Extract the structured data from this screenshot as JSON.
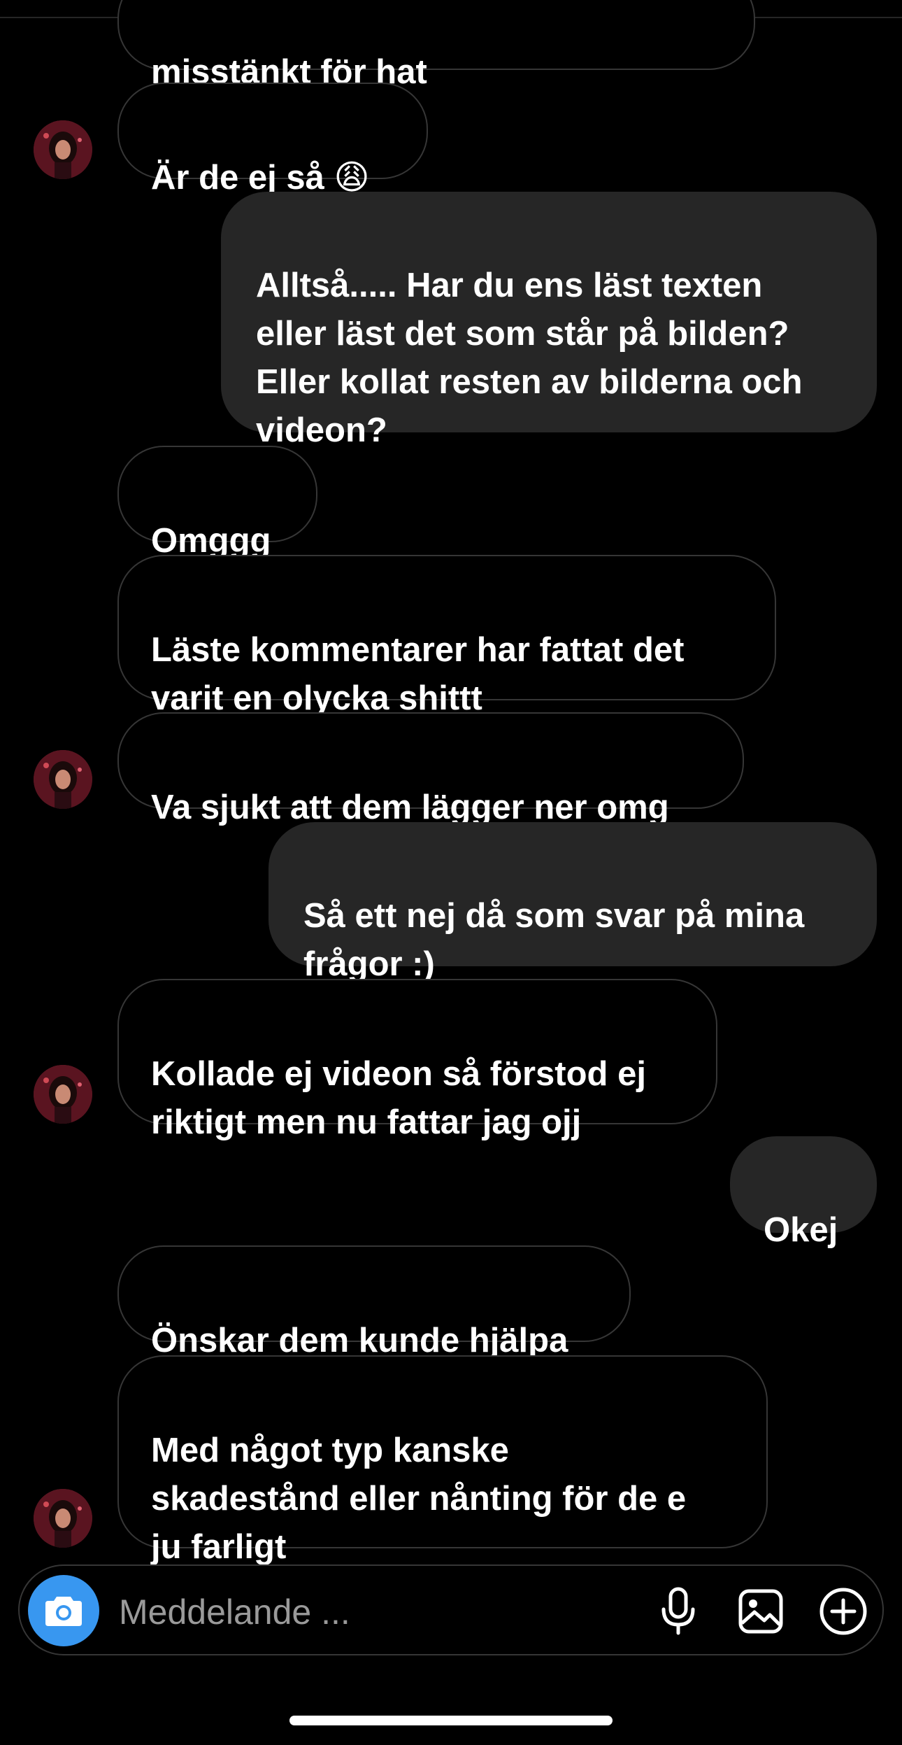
{
  "messages": [
    {
      "side": "in",
      "text": "misstänkt för hat"
    },
    {
      "side": "in",
      "text": "Är de ej så 😩"
    },
    {
      "side": "out",
      "text": "Alltså..... Har du ens läst texten\neller läst det som står på bilden?\nEller kollat resten av bilderna och\nvideon?"
    },
    {
      "side": "in",
      "text": "Omggg"
    },
    {
      "side": "in",
      "text": "Läste kommentarer har fattat det\nvarit en olycka shittt"
    },
    {
      "side": "in",
      "text": "Va sjukt att dem lägger ner omg"
    },
    {
      "side": "out",
      "text": "Så ett nej då som svar på mina\nfrågor :)"
    },
    {
      "side": "in",
      "text": "Kollade ej videon så förstod ej\nriktigt men nu fattar jag ojj"
    },
    {
      "side": "out",
      "text": "Okej"
    },
    {
      "side": "in",
      "text": "Önskar dem kunde hjälpa"
    },
    {
      "side": "in",
      "text": "Med något typ kanske\nskadestånd eller nånting för de e\nju farligt"
    }
  ],
  "composer": {
    "placeholder": "Meddelande ...",
    "icons": [
      "camera-icon",
      "microphone-icon",
      "gallery-icon",
      "plus-circle-icon"
    ]
  },
  "colors": {
    "background": "#000000",
    "outgoing_bubble": "#262626",
    "incoming_border": "#363636",
    "camera_button": "#3897f0",
    "placeholder": "#9a9a9a"
  }
}
